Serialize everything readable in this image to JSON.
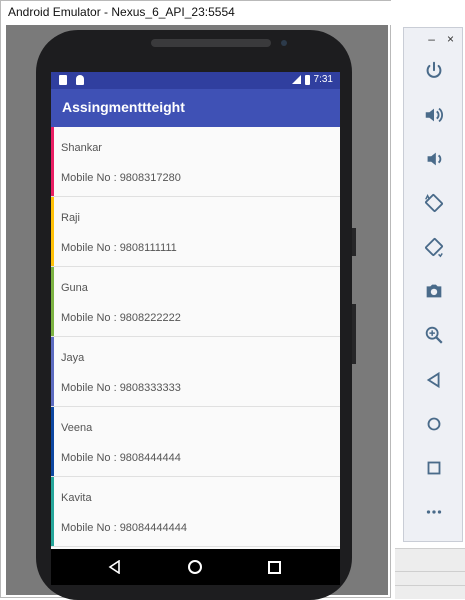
{
  "window": {
    "title": "Android Emulator - Nexus_6_API_23:5554"
  },
  "status_bar": {
    "time": "7:31"
  },
  "app": {
    "title": "Assingmenttteight"
  },
  "contacts": [
    {
      "name": "Shankar",
      "mobile": "Mobile No : 9808317280",
      "accent": "#e91e63"
    },
    {
      "name": "Raji",
      "mobile": "Mobile No : 9808111111",
      "accent": "#ffc107"
    },
    {
      "name": "Guna",
      "mobile": "Mobile No : 9808222222",
      "accent": "#7cb342"
    },
    {
      "name": "Jaya",
      "mobile": "Mobile No : 9808333333",
      "accent": "#5c6bc0"
    },
    {
      "name": "Veena",
      "mobile": "Mobile No : 9808444444",
      "accent": "#0d47a1"
    },
    {
      "name": "Kavita",
      "mobile": "Mobile No : 98084444444",
      "accent": "#26a69a"
    }
  ],
  "panel": {
    "minimize_label": "–",
    "close_label": "×",
    "buttons": [
      "power-icon",
      "volume-up-icon",
      "volume-down-icon",
      "rotate-left-icon",
      "rotate-right-icon",
      "camera-icon",
      "zoom-icon",
      "back-icon",
      "home-icon",
      "overview-icon",
      "more-icon"
    ],
    "icon_color": "#4a6b8a"
  },
  "theme": {
    "primary": "#3f51b5",
    "primary_dark": "#303f9f"
  }
}
